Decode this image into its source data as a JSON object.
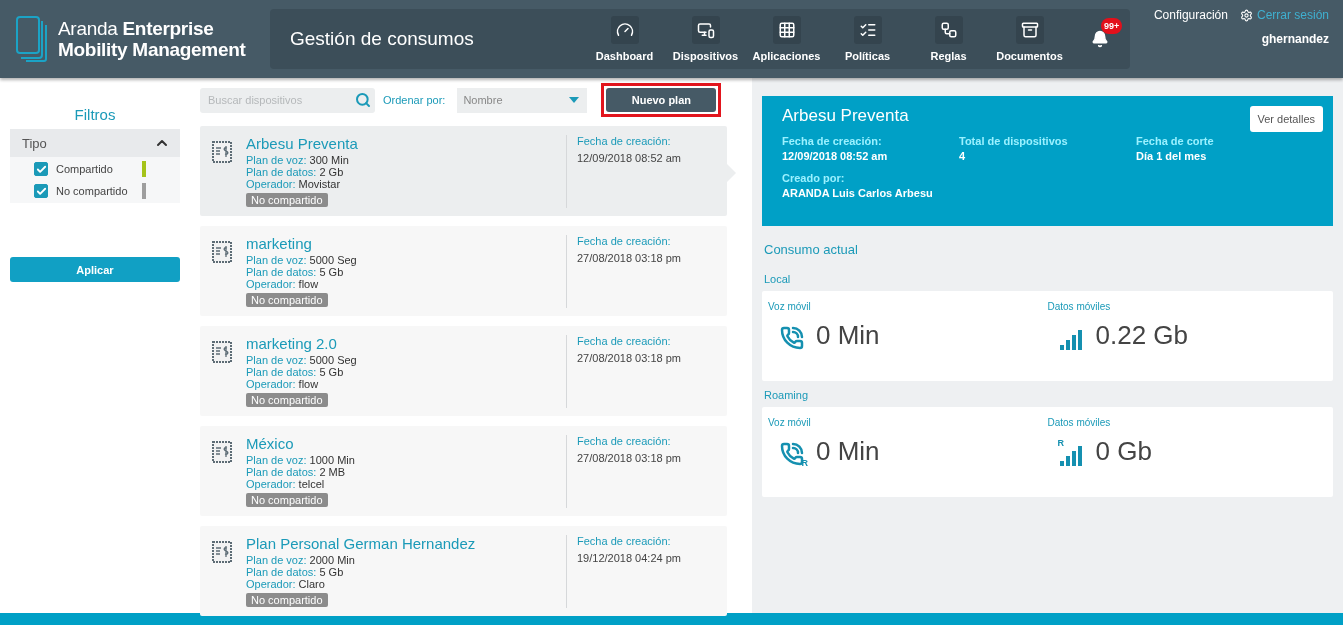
{
  "header": {
    "brand_light": "Aranda",
    "brand_bold": "Enterprise",
    "brand_line2": "Mobility Management",
    "page_title": "Gestión de consumos",
    "nav": [
      {
        "label": "Dashboard"
      },
      {
        "label": "Dispositivos"
      },
      {
        "label": "Aplicaciones"
      },
      {
        "label": "Políticas"
      },
      {
        "label": "Reglas"
      },
      {
        "label": "Documentos"
      }
    ],
    "notifications": "99+",
    "config": "Configuración",
    "logout": "Cerrar sesión",
    "user": "ghernandez"
  },
  "filters": {
    "title": "Filtros",
    "group": {
      "label": "Tipo",
      "expanded": true
    },
    "options": [
      {
        "label": "Compartido",
        "checked": true,
        "color": "#a5c31a"
      },
      {
        "label": "No compartido",
        "checked": true,
        "color": "#9e9e9e"
      }
    ],
    "apply": "Aplicar"
  },
  "toolbar": {
    "search": {
      "placeholder": "Buscar dispositivos"
    },
    "sort_label": "Ordenar por:",
    "sort_value": "Nombre",
    "new_plan": {
      "label": "Nuevo plan",
      "highlighted": true
    }
  },
  "plans": [
    {
      "name": "Arbesu Preventa",
      "selected": true,
      "voice_label": "Plan de voz:",
      "voice": "300 Min",
      "data_label": "Plan de datos:",
      "data": "2 Gb",
      "operator_label": "Operador:",
      "operator": "Movistar",
      "tag": "No compartido",
      "date_label": "Fecha de creación:",
      "date": "12/09/2018 08:52 am"
    },
    {
      "name": "marketing",
      "selected": false,
      "voice_label": "Plan de voz:",
      "voice": "5000 Seg",
      "data_label": "Plan de datos:",
      "data": "5 Gb",
      "operator_label": "Operador:",
      "operator": "flow",
      "tag": "No compartido",
      "date_label": "Fecha de creación:",
      "date": "27/08/2018 03:18 pm"
    },
    {
      "name": "marketing 2.0",
      "selected": false,
      "voice_label": "Plan de voz:",
      "voice": "5000 Seg",
      "data_label": "Plan de datos:",
      "data": "5 Gb",
      "operator_label": "Operador:",
      "operator": "flow",
      "tag": "No compartido",
      "date_label": "Fecha de creación:",
      "date": "27/08/2018 03:18 pm"
    },
    {
      "name": "México",
      "selected": false,
      "voice_label": "Plan de voz:",
      "voice": "1000 Min",
      "data_label": "Plan de datos:",
      "data": "2 MB",
      "operator_label": "Operador:",
      "operator": "telcel",
      "tag": "No compartido",
      "date_label": "Fecha de creación:",
      "date": "27/08/2018 03:18 pm"
    },
    {
      "name": "Plan Personal German Hernandez",
      "selected": false,
      "voice_label": "Plan de voz:",
      "voice": "2000 Min",
      "data_label": "Plan de datos:",
      "data": "5 Gb",
      "operator_label": "Operador:",
      "operator": "Claro",
      "tag": "No compartido",
      "date_label": "Fecha de creación:",
      "date": "19/12/2018 04:24 pm"
    }
  ],
  "detail": {
    "title": "Arbesu Preventa",
    "details_button": "Ver detalles",
    "fields": [
      {
        "label": "Fecha de creación:",
        "value": "12/09/2018 08:52 am"
      },
      {
        "label": "Total de dispositivos",
        "value": "4"
      },
      {
        "label": "Fecha de corte",
        "value": "Día 1 del mes"
      },
      {
        "label": "Creado por:",
        "value": "ARANDA Luis Carlos Arbesu"
      }
    ],
    "consumption_title": "Consumo actual",
    "sections": [
      {
        "title": "Local",
        "metrics": [
          {
            "kind": "voice",
            "label": "Voz móvil",
            "value": "0 Min"
          },
          {
            "kind": "data",
            "label": "Datos móviles",
            "value": "0.22 Gb"
          }
        ]
      },
      {
        "title": "Roaming",
        "metrics": [
          {
            "kind": "voice",
            "label": "Voz móvil",
            "value": "0 Min",
            "roaming_mark": "R"
          },
          {
            "kind": "data",
            "label": "Datos móviles",
            "value": "0 Gb",
            "roaming_mark": "R"
          }
        ]
      }
    ]
  }
}
